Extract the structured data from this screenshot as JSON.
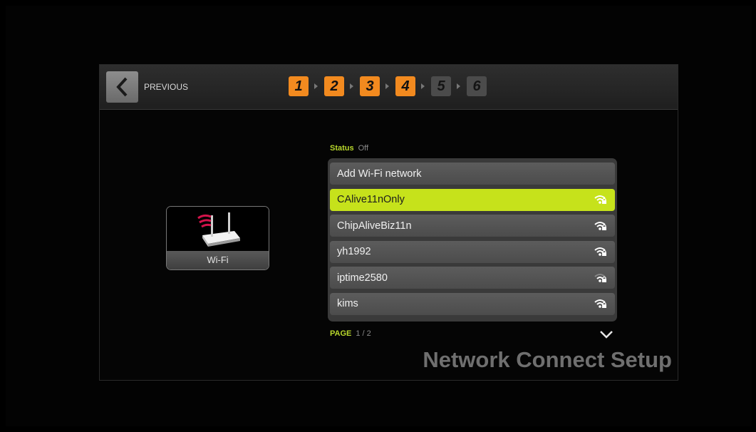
{
  "header": {
    "previous_label": "PREVIOUS",
    "steps": [
      {
        "label": "1",
        "state": "done"
      },
      {
        "label": "2",
        "state": "done"
      },
      {
        "label": "3",
        "state": "done"
      },
      {
        "label": "4",
        "state": "done"
      },
      {
        "label": "5",
        "state": "todo"
      },
      {
        "label": "6",
        "state": "todo"
      }
    ]
  },
  "device_card": {
    "label": "Wi-Fi",
    "icon": "wifi-router-icon"
  },
  "status": {
    "key": "Status",
    "value": "Off"
  },
  "networks": [
    {
      "name": "Add Wi-Fi network",
      "signal_icon": null,
      "selected": false
    },
    {
      "name": "CAlive11nOnly",
      "signal_icon": "secured-wifi-icon",
      "selected": true
    },
    {
      "name": "ChipAliveBiz11n",
      "signal_icon": "secured-wifi-icon",
      "selected": false
    },
    {
      "name": "yh1992",
      "signal_icon": "secured-wifi-icon",
      "selected": false
    },
    {
      "name": "iptime2580",
      "signal_icon": "secured-wifi-icon",
      "selected": false
    },
    {
      "name": "kims",
      "signal_icon": "secured-wifi-icon",
      "selected": false
    }
  ],
  "pagination": {
    "key": "PAGE",
    "value": "1 / 2"
  },
  "page_title": "Network Connect Setup",
  "colors": {
    "accent_orange": "#f28a1f",
    "accent_green": "#c6e21b",
    "step_inactive": "#4b4b4b"
  }
}
